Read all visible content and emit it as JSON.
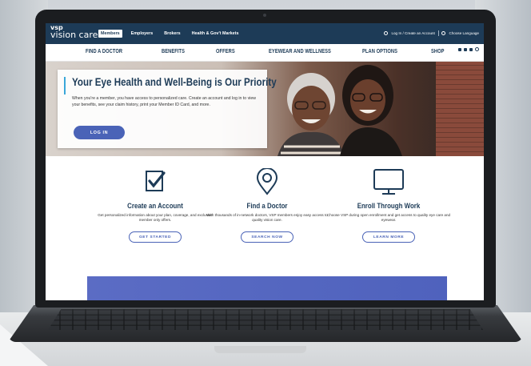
{
  "brand": {
    "logo_top": "vsp",
    "logo_bottom": "vision care"
  },
  "topnav": {
    "items": [
      "Members",
      "Employers",
      "Brokers",
      "Health & Gov't Markets"
    ],
    "active": "Members",
    "login": "Log In / Create an Account",
    "language": "Choose Language"
  },
  "mainnav": {
    "items": [
      "FIND A DOCTOR",
      "BENEFITS",
      "OFFERS",
      "EYEWEAR AND WELLNESS",
      "PLAN OPTIONS",
      "SHOP"
    ]
  },
  "hero": {
    "title": "Your Eye Health and Well-Being is Our Priority",
    "body": "When you're a member, you have access to personalized care. Create an account and log in to view your benefits, see your claim history, print your Member ID Card, and more.",
    "button": "LOG IN"
  },
  "features": [
    {
      "title": "Create an Account",
      "desc": "Get personalized information about your plan, coverage, and exclusive member only offers.",
      "button": "GET STARTED",
      "icon": "checkbox-icon"
    },
    {
      "title": "Find a Doctor",
      "desc": "With thousands of in-network doctors, VSP members enjoy easy access to quality vision care.",
      "button": "SEARCH NOW",
      "icon": "map-pin-icon"
    },
    {
      "title": "Enroll Through Work",
      "desc": "Choose VSP during open enrollment and get access to quality eye care and eyewear.",
      "button": "LEARN MORE",
      "icon": "monitor-icon"
    }
  ],
  "colors": {
    "navy": "#1d3b57",
    "accent": "#4a63b7",
    "hero_bar": "#3aa7d9"
  }
}
